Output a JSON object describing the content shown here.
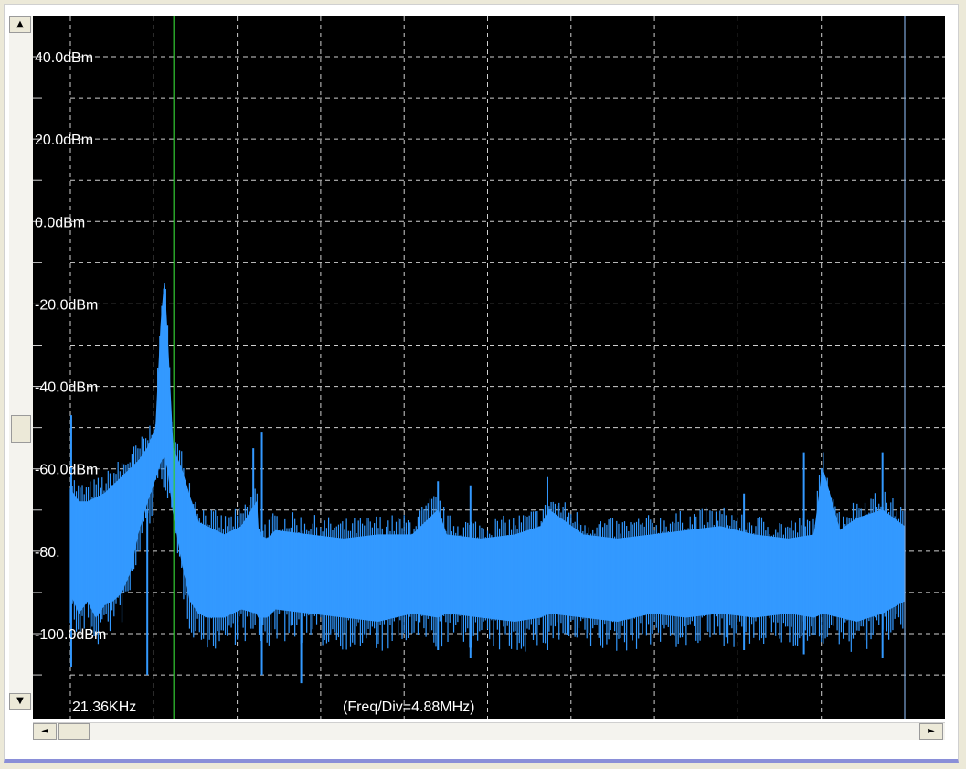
{
  "chart_data": {
    "type": "line",
    "title": "",
    "xlabel": "(Freq/Div=4.88MHz)",
    "ylabel": "",
    "x_start_label": "21.36KHz",
    "x_unit": "MHz",
    "xlim": [
      0,
      48.8
    ],
    "ylim": [
      -115,
      50
    ],
    "y_ticks": [
      40,
      20,
      0,
      -20,
      -40,
      -60,
      -80,
      -100
    ],
    "y_tick_labels": [
      "40.0dBm",
      "20.0dBm",
      "0.0dBm",
      "-20.0dBm",
      "-40.0dBm",
      "-60.0dBm",
      "-80.",
      "-100.0dBm"
    ],
    "grid": true,
    "series": [
      {
        "color": "#3399ff",
        "x": [
          0,
          0.5,
          1,
          1.5,
          2,
          2.5,
          3,
          3.5,
          4,
          4.5,
          5,
          5.3,
          5.5,
          5.7,
          6,
          6.5,
          7,
          7.5,
          8,
          9,
          10,
          10.9,
          11,
          11.5,
          12,
          14,
          16,
          18,
          20,
          21.5,
          22,
          24,
          26,
          27.5,
          28,
          30,
          32,
          34,
          36,
          38,
          40,
          42,
          43.5,
          44,
          45,
          46,
          47.5,
          48.8
        ],
        "y_top": [
          -65,
          -68,
          -68,
          -67,
          -66,
          -64,
          -62,
          -60,
          -58,
          -55,
          -50,
          -25,
          -15,
          -30,
          -55,
          -60,
          -67,
          -73,
          -74,
          -76,
          -74,
          -68,
          -76,
          -77,
          -75,
          -76,
          -77,
          -76,
          -76,
          -70,
          -76,
          -77,
          -76,
          -74,
          -70,
          -76,
          -77,
          -76,
          -75,
          -74,
          -76,
          -77,
          -76,
          -60,
          -75,
          -72,
          -70,
          -74
        ],
        "y_bottom": [
          -90,
          -95,
          -92,
          -96,
          -93,
          -92,
          -90,
          -85,
          -75,
          -68,
          -62,
          -58,
          -57,
          -60,
          -70,
          -82,
          -92,
          -95,
          -96,
          -96,
          -94,
          -95,
          -96,
          -96,
          -94,
          -95,
          -96,
          -97,
          -95,
          -96,
          -95,
          -96,
          -97,
          -96,
          -95,
          -96,
          -97,
          -95,
          -96,
          -95,
          -96,
          -95,
          -96,
          -95,
          -96,
          -97,
          -95,
          -92
        ]
      }
    ],
    "markers": [
      {
        "x": 6.05,
        "color": "#33cc33"
      },
      {
        "x": 48.8,
        "color": "#7fa7d8"
      }
    ],
    "spikes": [
      {
        "x": 0.05,
        "top": -47,
        "bottom": -108
      },
      {
        "x": 11.2,
        "top": -51,
        "bottom": -110
      },
      {
        "x": 10.7,
        "top": -55,
        "bottom": -95
      },
      {
        "x": 21.5,
        "top": -63,
        "bottom": -104
      },
      {
        "x": 23.4,
        "top": -64,
        "bottom": -106
      },
      {
        "x": 27.9,
        "top": -62,
        "bottom": -104
      },
      {
        "x": 42.9,
        "top": -56,
        "bottom": -105
      },
      {
        "x": 47.5,
        "top": -56,
        "bottom": -106
      },
      {
        "x": 13.5,
        "top": -78,
        "bottom": -112
      },
      {
        "x": 4.5,
        "top": -70,
        "bottom": -110
      },
      {
        "x": 39.4,
        "top": -66,
        "bottom": -104
      }
    ]
  },
  "ui": {
    "scroll_up_glyph": "▲",
    "scroll_down_glyph": "▼",
    "scroll_left_glyph": "◄",
    "scroll_right_glyph": "►"
  }
}
